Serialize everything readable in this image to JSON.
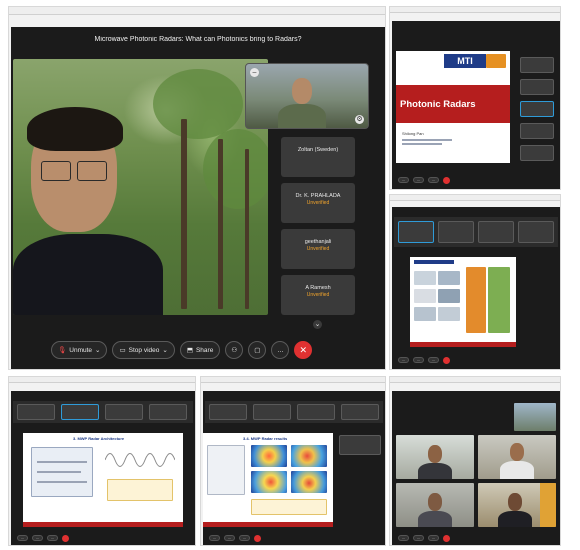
{
  "collage": {
    "main": {
      "meeting_title": "Microwave Photonic Radars: What can Photonics bring to Radars?",
      "participants": [
        {
          "name": "Zoltan (Sweden)",
          "status": ""
        },
        {
          "name": "Dr. K. PRAHLADA",
          "status": "Unverified"
        },
        {
          "name": "geethanjali",
          "status": "Unverified"
        },
        {
          "name": "A Ramesh",
          "status": "Unverified"
        }
      ],
      "controls": {
        "unmute": "Unmute",
        "stop_video": "Stop video",
        "share": "Share"
      },
      "icons": {
        "mic_muted": "mic-off-icon",
        "camera": "camera-icon",
        "share": "share-screen-icon",
        "end": "end-call-icon"
      }
    },
    "top_right": {
      "slide_logo": "MTI",
      "slide_heading": "Photonic Radars",
      "slide_author": "Shilong Pan"
    },
    "bottom_left": {
      "slide_title": "3. MWP Radar Architecture"
    },
    "bottom_middle": {
      "slide_title": "3.4. MWP Radar results"
    },
    "colors": {
      "meeting_bg": "#1b1b1b",
      "tile_bg": "#3a3a3a",
      "unverified": "#f0a32c",
      "end_button": "#e03131",
      "slide_red": "#b51e1e"
    }
  }
}
